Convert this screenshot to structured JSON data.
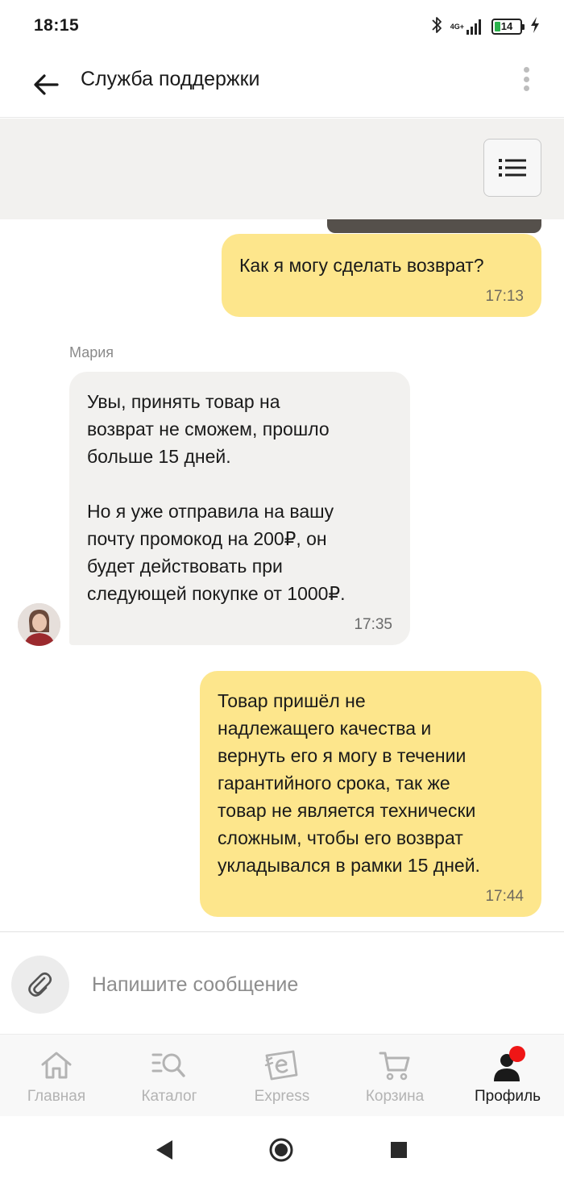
{
  "status_bar": {
    "time": "18:15",
    "network": "4G+",
    "battery_level": "14"
  },
  "header": {
    "title": "Служба поддержки"
  },
  "messages": [
    {
      "direction": "outgoing",
      "text": "Как я могу сделать возврат?",
      "time": "17:13"
    },
    {
      "direction": "incoming",
      "sender": "Мария",
      "text": "Увы, принять товар на\nвозврат не сможем, прошло\nбольше 15 дней.\n\nНо я уже отправила на вашу\nпочту промокод на 200₽, он\nбудет действовать при\nследующей покупке от 1000₽.",
      "time": "17:35"
    },
    {
      "direction": "outgoing",
      "text": "Товар пришёл не\nнадлежащего качества и\nвернуть его я могу в течении\nгарантийного срока, так же\nтовар не является технически\nсложным, чтобы его возврат\nукладывался в рамки 15 дней.",
      "time": "17:44"
    }
  ],
  "composer": {
    "placeholder": "Напишите сообщение"
  },
  "bottom_nav": {
    "items": [
      {
        "label": "Главная",
        "icon": "home-icon",
        "active": false
      },
      {
        "label": "Каталог",
        "icon": "catalog-search-icon",
        "active": false
      },
      {
        "label": "Express",
        "icon": "express-icon",
        "active": false
      },
      {
        "label": "Корзина",
        "icon": "cart-icon",
        "active": false
      },
      {
        "label": "Профиль",
        "icon": "profile-icon",
        "active": true
      }
    ]
  },
  "colors": {
    "outgoing_bubble": "#fde68c",
    "incoming_bubble": "#f2f1ef",
    "notification_dot": "#ef1616"
  }
}
